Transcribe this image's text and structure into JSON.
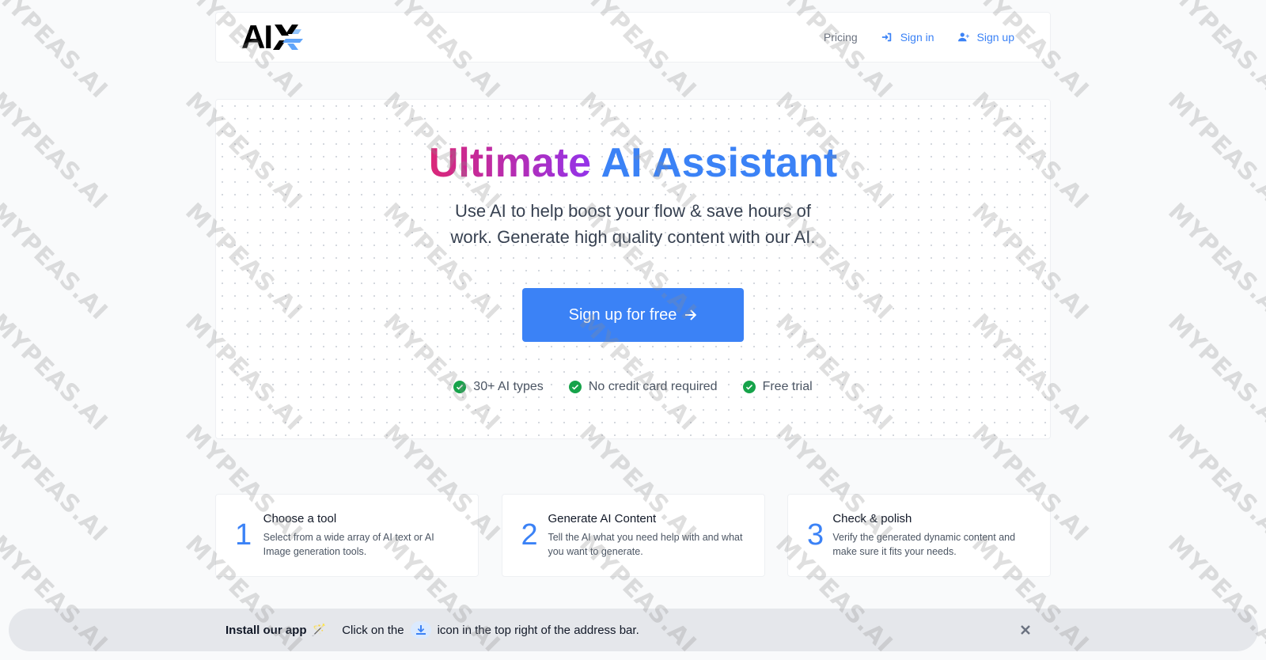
{
  "header": {
    "logo_text": "AI",
    "nav": {
      "pricing": "Pricing",
      "sign_in": "Sign in",
      "sign_up": "Sign up"
    }
  },
  "hero": {
    "title_part1": "Ultimate",
    "title_part2": "AI Assistant",
    "subtitle": "Use AI to help boost your flow & save hours of work. Generate high quality content with our AI.",
    "cta_label": "Sign up for free",
    "features": [
      "30+ AI types",
      "No credit card required",
      "Free trial"
    ]
  },
  "steps": [
    {
      "num": "1",
      "title": "Choose a tool",
      "desc": "Select from a wide array of AI text or AI Image generation tools."
    },
    {
      "num": "2",
      "title": "Generate AI Content",
      "desc": "Tell the AI what you need help with and what you want to generate."
    },
    {
      "num": "3",
      "title": "Check & polish",
      "desc": "Verify the generated dynamic content and make sure it fits your needs."
    }
  ],
  "install_bar": {
    "title": "Install our app",
    "wand": "🪄",
    "text_before": "Click on the",
    "text_after": "icon in the top right of the address bar."
  },
  "watermark": "MYPEAS.AI",
  "colors": {
    "accent": "#3b82f6",
    "gradient_start": "#db2777",
    "gradient_end": "#9333ea",
    "check_green": "#16a34a",
    "background": "#f9fafb"
  },
  "icons": {
    "sign_in": "sign-in-icon",
    "sign_up": "user-plus-icon",
    "cta_arrow": "arrow-right-icon",
    "feature_check": "check-circle-icon",
    "install": "download-icon",
    "close": "close-icon"
  }
}
